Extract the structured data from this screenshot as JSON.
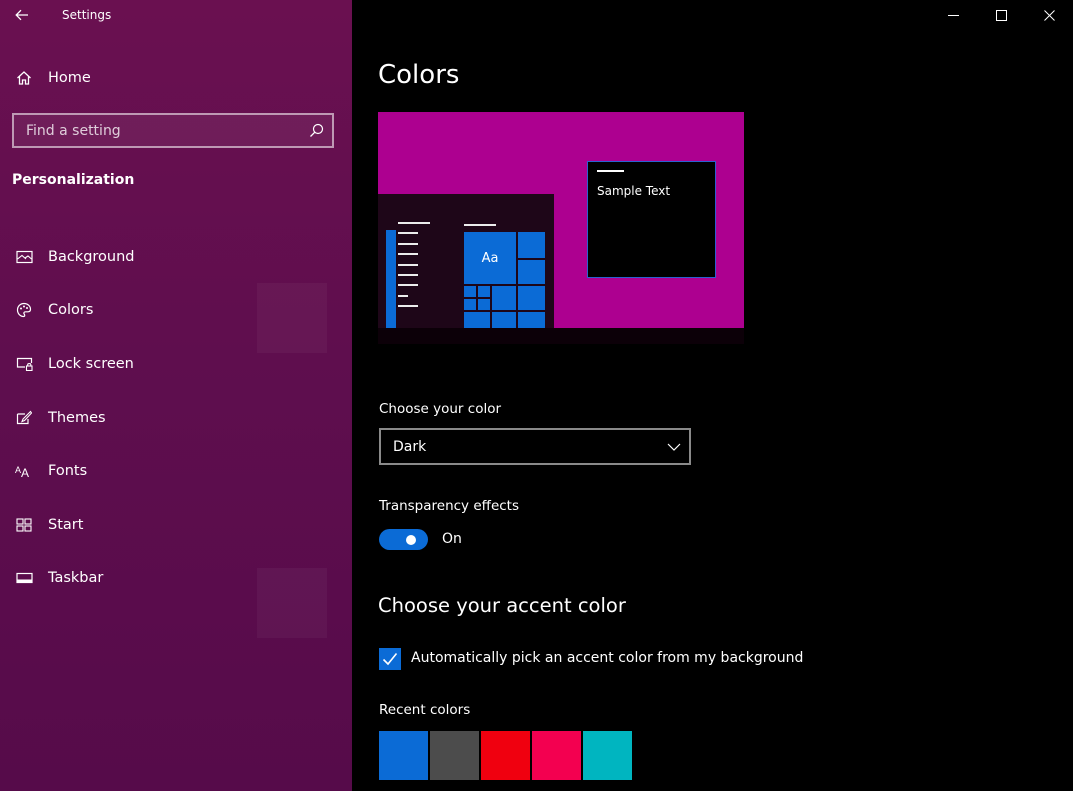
{
  "app": {
    "title": "Settings"
  },
  "sidebar": {
    "home_label": "Home",
    "search_placeholder": "Find a setting",
    "section_header": "Personalization",
    "items": [
      {
        "label": "Background",
        "icon": "picture-icon"
      },
      {
        "label": "Colors",
        "icon": "palette-icon"
      },
      {
        "label": "Lock screen",
        "icon": "lock-screen-icon"
      },
      {
        "label": "Themes",
        "icon": "themes-icon"
      },
      {
        "label": "Fonts",
        "icon": "fonts-icon"
      },
      {
        "label": "Start",
        "icon": "start-icon"
      },
      {
        "label": "Taskbar",
        "icon": "taskbar-icon"
      }
    ]
  },
  "main": {
    "title": "Colors",
    "preview": {
      "sample_text": "Sample Text",
      "tile_text": "Aa"
    },
    "choose_color": {
      "label": "Choose your color",
      "value": "Dark"
    },
    "transparency": {
      "label": "Transparency effects",
      "state": "On",
      "enabled": true
    },
    "accent": {
      "title": "Choose your accent color",
      "auto_pick_label": "Automatically pick an accent color from my background",
      "auto_pick_checked": true,
      "recent_label": "Recent colors",
      "recent_colors": [
        "#0b6bd6",
        "#4c4c4c",
        "#f0000f",
        "#f30050",
        "#00b5c0"
      ]
    }
  },
  "colors": {
    "accent": "#0b6bd6",
    "sidebar_bg": "#5f0e4e",
    "preview_bg": "#ad0090"
  }
}
